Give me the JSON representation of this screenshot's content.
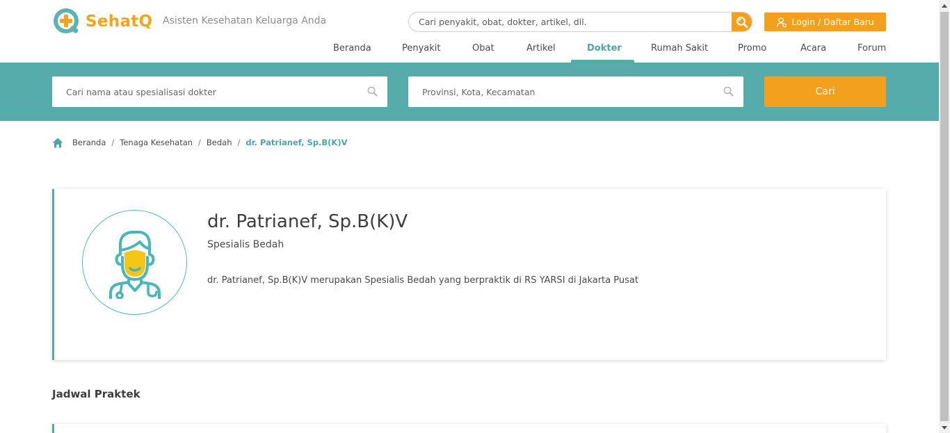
{
  "header": {
    "logo_text": "SehatQ",
    "tagline": "Asisten Kesehatan Keluarga Anda",
    "search_placeholder": "Cari penyakit, obat, dokter, artikel, dll.",
    "login_label": "Login / Daftar Baru"
  },
  "nav": {
    "items": [
      {
        "label": "Beranda",
        "active": false
      },
      {
        "label": "Penyakit",
        "active": false
      },
      {
        "label": "Obat",
        "active": false
      },
      {
        "label": "Artikel",
        "active": false
      },
      {
        "label": "Dokter",
        "active": true
      },
      {
        "label": "Rumah Sakit",
        "active": false
      },
      {
        "label": "Promo",
        "active": false
      },
      {
        "label": "Acara",
        "active": false
      },
      {
        "label": "Forum",
        "active": false
      }
    ]
  },
  "doctor_search": {
    "name_placeholder": "Cari nama atau spesialisasi dokter",
    "location_placeholder": "Provinsi, Kota, Kecamatan",
    "button_label": "Cari"
  },
  "breadcrumb": {
    "items": [
      "Beranda",
      "Tenaga Kesehatan",
      "Bedah"
    ],
    "current": "dr. Patrianef, Sp.B(K)V"
  },
  "doctor": {
    "name": "dr. Patrianef, Sp.B(K)V",
    "specialty": "Spesialis Bedah",
    "description": "dr. Patrianef, Sp.B(K)V merupakan Spesialis Bedah yang berpraktik di RS YARSI di Jakarta Pusat"
  },
  "schedule": {
    "title": "Jadwal Praktek"
  },
  "colors": {
    "teal": "#56abab",
    "orange": "#f2a01d",
    "text": "#4a4a4a"
  },
  "icons": [
    "logo-icon",
    "search-icon",
    "user-icon",
    "home-icon",
    "doctor-avatar-icon"
  ]
}
